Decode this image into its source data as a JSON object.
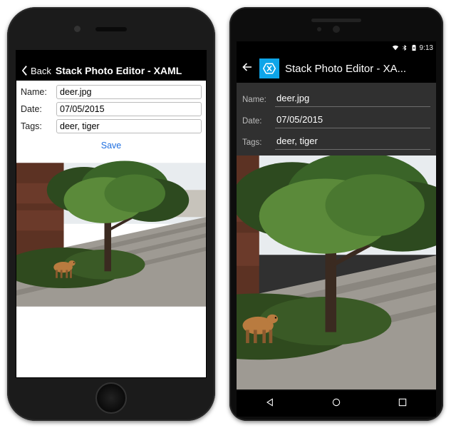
{
  "ios": {
    "nav": {
      "back_label": "Back",
      "title": "Stack Photo Editor - XAML"
    },
    "form": {
      "name_label": "Name:",
      "date_label": "Date:",
      "tags_label": "Tags:",
      "name_value": "deer.jpg",
      "date_value": "07/05/2015",
      "tags_value": "deer, tiger",
      "save_label": "Save"
    }
  },
  "android": {
    "status": {
      "time": "9:13"
    },
    "appbar": {
      "title": "Stack Photo Editor - XA..."
    },
    "form": {
      "name_label": "Name:",
      "date_label": "Date:",
      "tags_label": "Tags:",
      "name_value": "deer.jpg",
      "date_value": "07/05/2015",
      "tags_value": "deer, tiger"
    },
    "nav": {
      "back_icon": "triangle",
      "home_icon": "circle",
      "recent_icon": "square"
    }
  },
  "photo": {
    "description": "deer under tree on brick-paved walkway",
    "sky": "#e8ecef",
    "building_brick": "#6b3a2a",
    "planter_green": "#2f4a1e",
    "foliage_light": "#5b8a3a",
    "foliage_dark": "#2d4a1f",
    "trunk": "#3a2a20",
    "path": "#9e9a93",
    "deer": "#b97b3f"
  }
}
